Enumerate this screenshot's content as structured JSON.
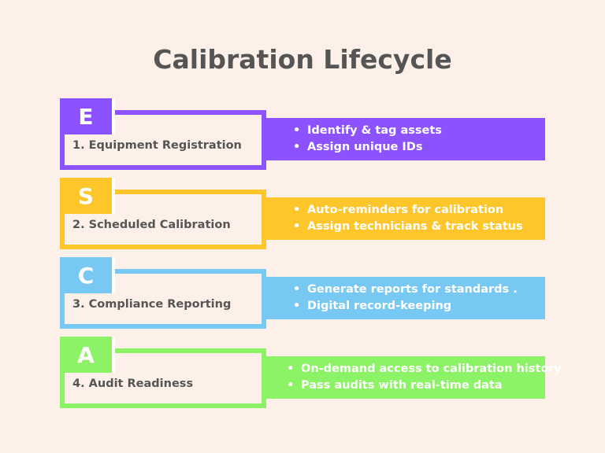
{
  "title": "Calibration Lifecycle",
  "steps": [
    {
      "letter": "E",
      "label": "1. Equipment Registration",
      "color": "#8c52ff",
      "bullets": [
        "Identify & tag assets",
        "Assign unique IDs"
      ]
    },
    {
      "letter": "S",
      "label": "2. Scheduled Calibration",
      "color": "#ffc62c",
      "bullets": [
        "Auto-reminders for calibration",
        "Assign technicians & track status"
      ]
    },
    {
      "letter": "C",
      "label": "3. Compliance Reporting",
      "color": "#77c8f2",
      "bullets": [
        "Generate reports for standards .",
        "Digital record-keeping"
      ]
    },
    {
      "letter": "A",
      "label": "4. Audit Readiness",
      "color": "#8cf366",
      "bullets": [
        "On-demand access to calibration history",
        "Pass audits with real-time data"
      ]
    }
  ]
}
